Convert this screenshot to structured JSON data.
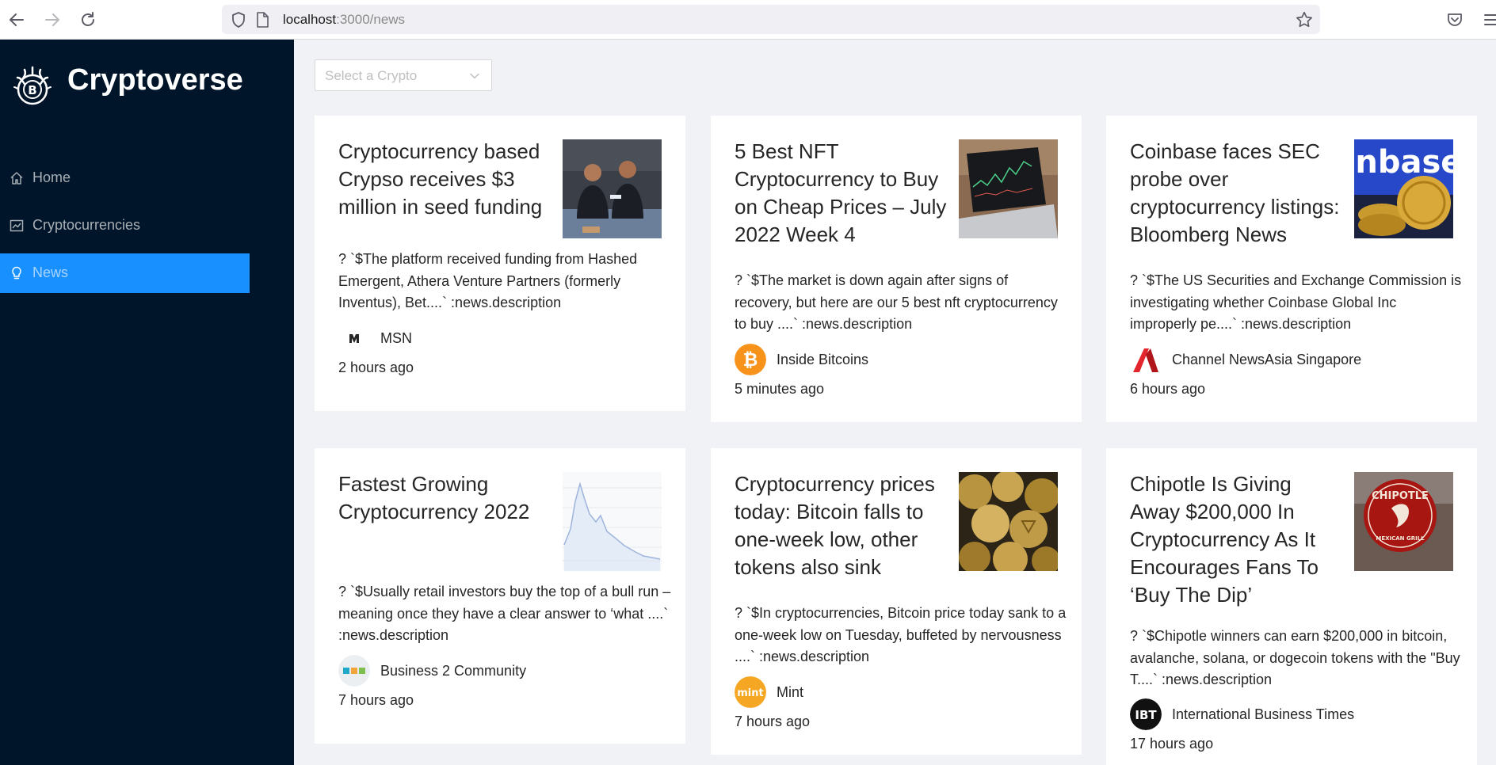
{
  "browser": {
    "url_host": "localhost",
    "url_path": ":3000/news"
  },
  "sidebar": {
    "brand": "Cryptoverse",
    "items": [
      {
        "label": "Home",
        "icon": "home-icon"
      },
      {
        "label": "Cryptocurrencies",
        "icon": "chart-icon"
      },
      {
        "label": "News",
        "icon": "bulb-icon"
      }
    ],
    "selected": "News"
  },
  "filter": {
    "placeholder": "Select a Crypto"
  },
  "colors": {
    "sidebar_bg": "#001529",
    "accent": "#1890ff",
    "page_bg": "#f0f2f5"
  },
  "news": [
    {
      "title": "Cryptocurrency based Crypso receives $3 million in seed funding",
      "description": "? `$The platform received funding from Hashed Emergent, Athera Venture Partners (formerly Inventus), Bet....` :news.description",
      "provider": "MSN",
      "provider_icon": "msn-logo-icon",
      "time": "2 hours ago",
      "thumb_icon": "founders-photo-icon"
    },
    {
      "title": "5 Best NFT Cryptocurrency to Buy on Cheap Prices – July 2022 Week 4",
      "description": "? `$The market is down again after signs of recovery, but here are our 5 best nft cryptocurrency to buy ....` :news.description",
      "provider": "Inside Bitcoins",
      "provider_icon": "bitcoin-logo-icon",
      "time": "5 minutes ago",
      "thumb_icon": "laptop-chart-photo-icon"
    },
    {
      "title": "Coinbase faces SEC probe over cryptocurrency listings: Bloomberg News",
      "description": "? `$The US Securities and Exchange Commission is investigating whether Coinbase Global Inc improperly pe....` :news.description",
      "provider": "Channel NewsAsia Singapore",
      "provider_icon": "cna-logo-icon",
      "time": "6 hours ago",
      "thumb_icon": "coinbase-coins-photo-icon",
      "thumb_text": "inbase"
    },
    {
      "title": "Fastest Growing Cryptocurrency 2022",
      "description": "? `$Usually retail investors buy the top of a bull run – meaning once they have a clear answer to ‘what ....` :news.description",
      "provider": "Business 2 Community",
      "provider_icon": "b2c-logo-icon",
      "time": "7 hours ago",
      "thumb_icon": "price-chart-thumbnail-icon"
    },
    {
      "title": "Cryptocurrency prices today: Bitcoin falls to one-week low, other tokens also sink",
      "description": "? `$In cryptocurrencies, Bitcoin price today sank to a one-week low on Tuesday, buffeted by nervousness ....` :news.description",
      "provider": "Mint",
      "provider_icon": "mint-logo-icon",
      "provider_logo_text": "mint",
      "time": "7 hours ago",
      "thumb_icon": "gold-coins-photo-icon"
    },
    {
      "title": "Chipotle Is Giving Away $200,000 In Cryptocurrency As It Encourages Fans To ‘Buy The Dip’",
      "description": "? `$Chipotle winners can earn $200,000 in bitcoin, avalanche, solana, or dogecoin tokens with the \"Buy T....` :news.description",
      "provider": "International Business Times",
      "provider_icon": "ibt-logo-icon",
      "provider_logo_text": "IBT",
      "time": "17 hours ago",
      "thumb_icon": "chipotle-sign-photo-icon",
      "thumb_text": "CHIPOTLE",
      "thumb_subtext": "MEXICAN GRILL"
    }
  ]
}
